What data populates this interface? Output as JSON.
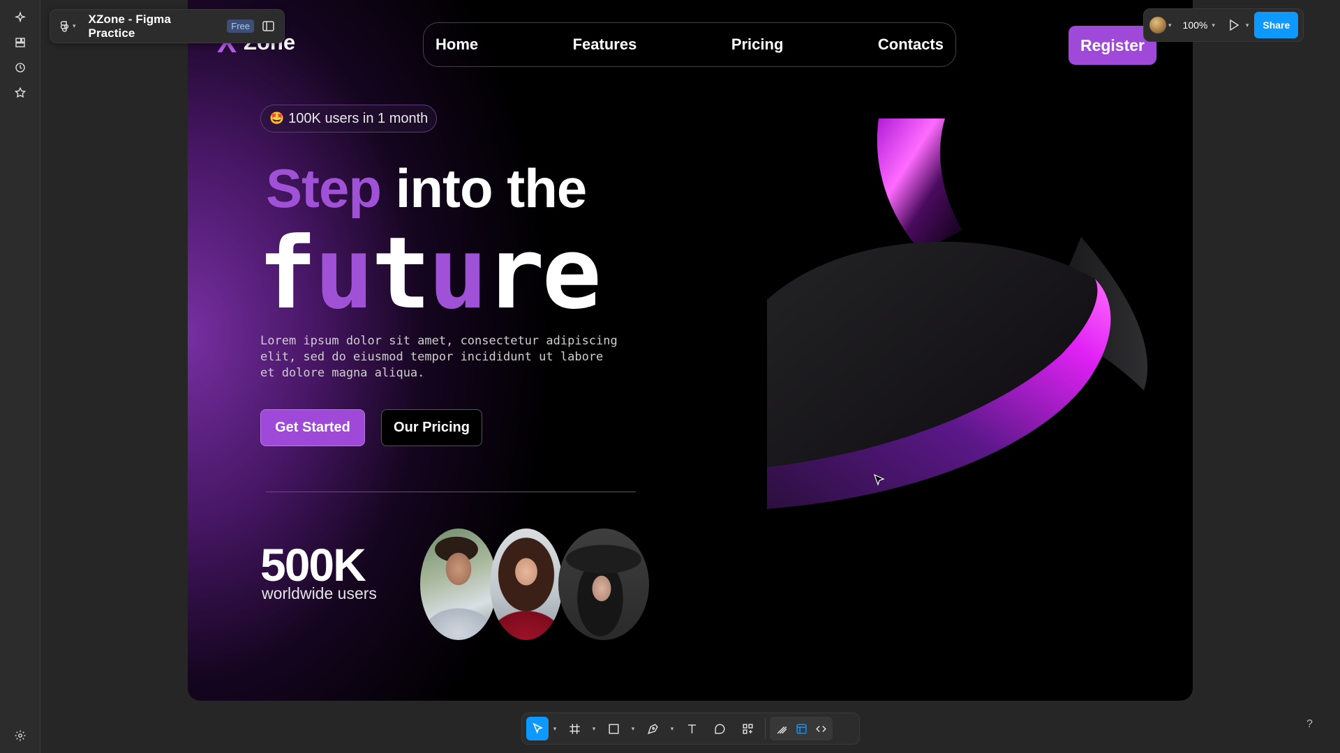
{
  "app": {
    "file_title": "XZone - Figma Practice",
    "plan_badge": "Free",
    "zoom_label": "100%",
    "share_label": "Share",
    "help_label": "?"
  },
  "left_rail": {
    "items": [
      {
        "icon": "sparkle-icon"
      },
      {
        "icon": "assets-icon"
      },
      {
        "icon": "history-icon"
      },
      {
        "icon": "star-icon"
      }
    ],
    "bottom_icon": "settings-icon"
  },
  "site": {
    "logo_mark": "X",
    "logo_text": "Zone",
    "nav": [
      "Home",
      "Features",
      "Pricing",
      "Contacts"
    ],
    "register_label": "Register",
    "badge_emoji": "🤩",
    "badge_text": "100K users in 1 month",
    "headline_accent": "Step",
    "headline_rest": "into the",
    "headline_big": [
      "f",
      "u",
      "t",
      "u",
      "r",
      "e"
    ],
    "body_text": "Lorem ipsum dolor sit amet, consectetur adipiscing elit, sed do eiusmod tempor incididunt ut labore et dolore magna aliqua.",
    "cta_primary": "Get Started",
    "cta_secondary": "Our Pricing",
    "stat_number": "500K",
    "stat_label": "worldwide users"
  },
  "toolbar": {
    "tools": [
      "move-tool",
      "frame-tool",
      "shape-tool",
      "pen-tool",
      "text-tool",
      "comment-tool",
      "actions-tool"
    ],
    "modes": [
      "draw-mode",
      "design-mode",
      "dev-mode"
    ]
  },
  "colors": {
    "accent": "#9f49d8",
    "share_blue": "#0d99ff",
    "canvas_bg": "#262626"
  }
}
